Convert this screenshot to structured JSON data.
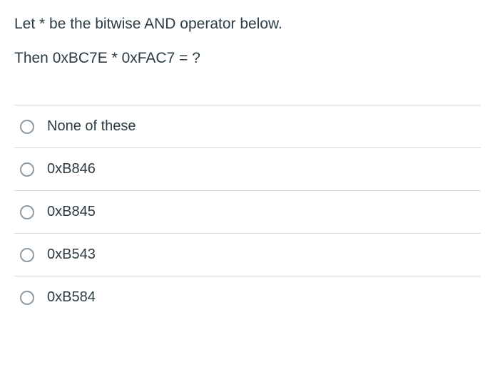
{
  "question": {
    "line1": "Let * be the bitwise AND operator below.",
    "line2": "Then   0xBC7E * 0xFAC7  = ?"
  },
  "options": [
    {
      "label": "None of these"
    },
    {
      "label": "0xB846"
    },
    {
      "label": "0xB845"
    },
    {
      "label": "0xB543"
    },
    {
      "label": "0xB584"
    }
  ]
}
